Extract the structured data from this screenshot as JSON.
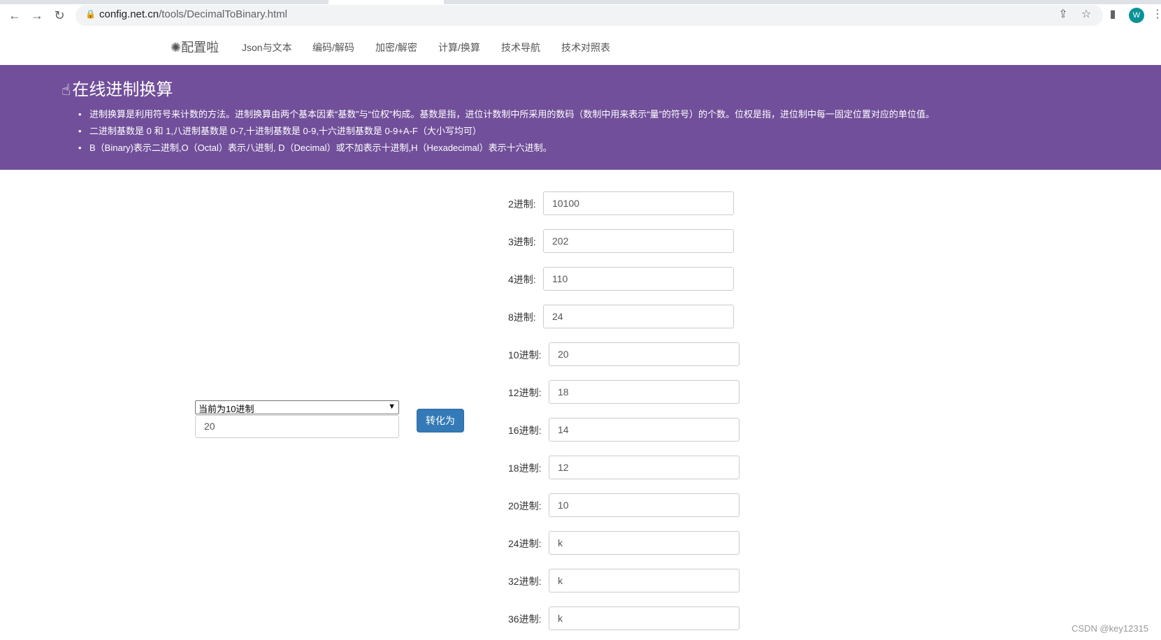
{
  "browser": {
    "url_host": "config.net.cn",
    "url_path": "/tools/DecimalToBinary.html",
    "profile_initial": "W"
  },
  "nav": {
    "brand": "✺配置啦",
    "links": [
      "Json与文本",
      "编码/解码",
      "加密/解密",
      "计算/换算",
      "技术导航",
      "技术对照表"
    ]
  },
  "hero": {
    "title": "在线进制换算",
    "bullets": [
      "进制换算是利用符号来计数的方法。进制换算由两个基本因素“基数”与“位权”构成。基数是指，进位计数制中所采用的数码（数制中用来表示“量”的符号）的个数。位权是指，进位制中每一固定位置对应的单位值。",
      "二进制基数是 0 和 1,八进制基数是 0-7,十进制基数是 0-9,十六进制基数是 0-9+A-F（大小写均可）",
      "B（Binary)表示二进制,O（Octal）表示八进制, D（Decimal）或不加表示十进制,H（Hexadecimal）表示十六进制。"
    ]
  },
  "converter": {
    "select_value": "当前为10进制",
    "input_value": "20",
    "button_label": "转化为"
  },
  "results": [
    {
      "label": "2进制:",
      "value": "10100"
    },
    {
      "label": "3进制:",
      "value": "202"
    },
    {
      "label": "4进制:",
      "value": "110"
    },
    {
      "label": "8进制:",
      "value": "24"
    },
    {
      "label": "10进制:",
      "value": "20"
    },
    {
      "label": "12进制:",
      "value": "18"
    },
    {
      "label": "16进制:",
      "value": "14"
    },
    {
      "label": "18进制:",
      "value": "12"
    },
    {
      "label": "20进制:",
      "value": "10"
    },
    {
      "label": "24进制:",
      "value": "k"
    },
    {
      "label": "32进制:",
      "value": "k"
    },
    {
      "label": "36进制:",
      "value": "k"
    }
  ],
  "watermark": "CSDN @key12315",
  "colors": {
    "hero_bg": "#714f9a",
    "button_bg": "#337ab7",
    "link": "#555555"
  }
}
